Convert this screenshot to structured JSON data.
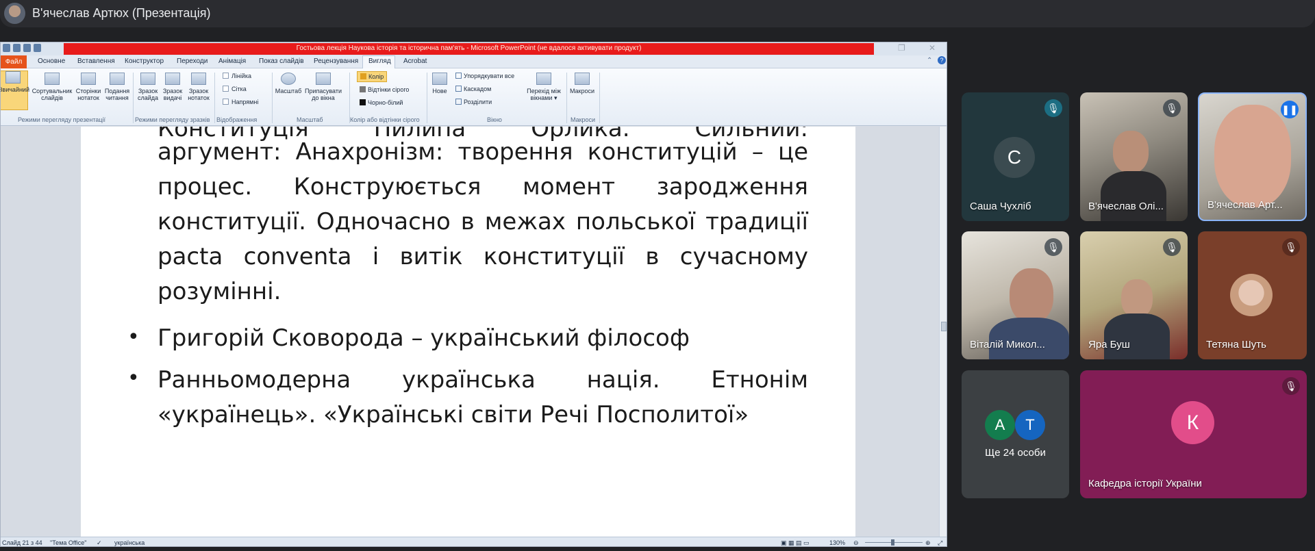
{
  "meet": {
    "presenter_title": "В'ячеслав Артюх (Презентація)"
  },
  "ppt": {
    "window_title": "Гостьова лекція Наукова історія та історична пам'ять  -  Microsoft PowerPoint (не вдалося активувати продукт)",
    "tabs": {
      "file": "Файл",
      "items": [
        "Основне",
        "Вставлення",
        "Конструктор",
        "Переходи",
        "Анімація",
        "Показ слайдів",
        "Рецензування",
        "Вигляд",
        "Acrobat"
      ]
    },
    "ribbon": {
      "views": [
        "Звичайний",
        "Сортувальник слайдів",
        "Сторінки нотаток",
        "Подання читання"
      ],
      "masters": [
        "Зразок слайда",
        "Зразок видачі",
        "Зразок нотаток"
      ],
      "show": [
        "Лінійка",
        "Сітка",
        "Напрямні"
      ],
      "zoom": [
        "Масштаб",
        "Припасувати до вікна"
      ],
      "color": [
        "Колір",
        "Відтінки сірого",
        "Чорно-білий"
      ],
      "window": [
        "Нове",
        "Упорядкувати все",
        "Каскадом",
        "Розділити",
        "Перехід між вікнами"
      ],
      "macros": "Макроси",
      "groups": [
        "Режими перегляду презентації",
        "Режими перегляду зразків",
        "Відображення",
        "Масштаб",
        "Колір або відтінки сірого",
        "Вікно",
        "Макроси"
      ]
    },
    "slide": {
      "para1_top": "Конституція Пилипа Орлика. Сильний:",
      "para1": "аргумент: Анахронізм: творення конституцій – це процес. Конструюється  момент зародження конституції. Одночасно в межах польської традиції  pacta conventa і витік конституції в сучасному розумінні.",
      "bullet2": "Григорій Сковорода – український філософ",
      "bullet3": "Ранньомодерна українська нація. Етнонім «українець». «Українські світи Речі Посполитої»"
    },
    "status": {
      "slide": "Слайд 21 з 44",
      "theme": "\"Тема Office\"",
      "language": "українська",
      "zoom": "130%"
    }
  },
  "participants": [
    {
      "name": "Саша Чухліб",
      "initial": "С"
    },
    {
      "name": "В'ячеслав Олі..."
    },
    {
      "name": "В'ячеслав Арт..."
    },
    {
      "name": "Віталій Микол..."
    },
    {
      "name": "Яра Буш"
    },
    {
      "name": "Тетяна Шуть"
    },
    {
      "name": "Ще 24 особи",
      "initials": [
        "А",
        "Т"
      ]
    },
    {
      "name": "Кафедра історії України",
      "initial": "К"
    }
  ]
}
